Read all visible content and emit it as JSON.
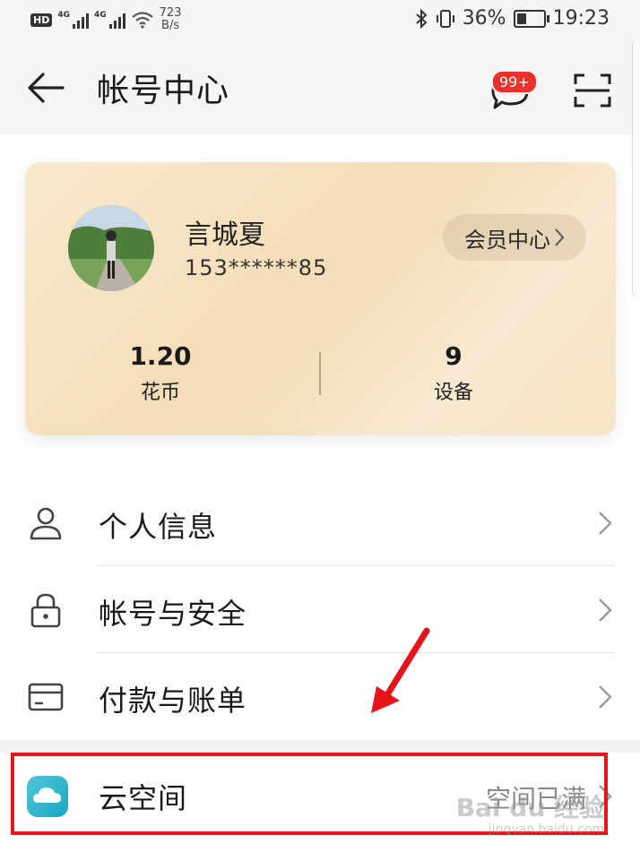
{
  "status_bar": {
    "hd": "HD",
    "sim1_label": "4G",
    "sim2_label": "4G",
    "speed_value": "723",
    "speed_unit": "B/s",
    "battery_percent": "36%",
    "battery_level": 0.36,
    "time": "19:23"
  },
  "header": {
    "title": "帐号中心",
    "message_badge": "99+"
  },
  "account": {
    "name": "言城夏",
    "phone": "153******85",
    "member_button": "会员中心",
    "stats": [
      {
        "value": "1.20",
        "label": "花币"
      },
      {
        "value": "9",
        "label": "设备"
      }
    ]
  },
  "menu": {
    "items": [
      {
        "label": "个人信息",
        "icon": "person-icon"
      },
      {
        "label": "帐号与安全",
        "icon": "lock-icon"
      },
      {
        "label": "付款与账单",
        "icon": "card-icon"
      }
    ],
    "cloud": {
      "label": "云空间",
      "status": "空间已满",
      "icon": "cloud-icon"
    }
  },
  "watermark": {
    "brand": "Bai du 经验",
    "url": "jingyan.baidu.com"
  },
  "colors": {
    "card_gold": "#f4ddb8",
    "badge_red": "#e6322b",
    "highlight_red": "#e8141a",
    "cloud_teal": "#1aa6c2"
  }
}
